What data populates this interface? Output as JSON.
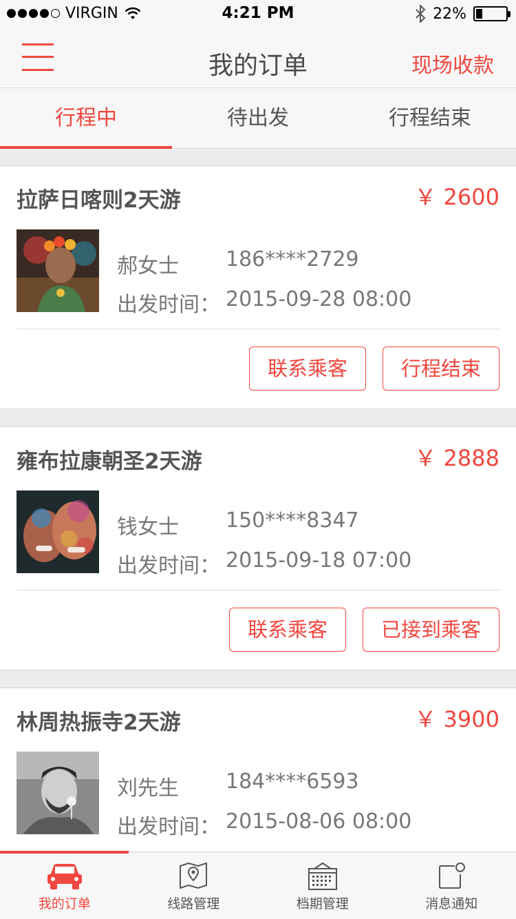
{
  "status_bar": {
    "carrier": "VIRGIN",
    "time": "4:21 PM",
    "battery": "22%",
    "battery_level": 0.22
  },
  "nav": {
    "title": "我的订单",
    "action": "现场收款",
    "menu_icon": "hamburger-menu-icon"
  },
  "tabs": [
    {
      "label": "行程中",
      "active": true
    },
    {
      "label": "待出发",
      "active": false
    },
    {
      "label": "行程结束",
      "active": false
    }
  ],
  "orders": [
    {
      "route": "拉萨日喀则2天游",
      "price": "￥ 2600",
      "passenger": "郝女士",
      "phone": "186****2729",
      "depart_label": "出发时间：",
      "depart_time": "2015-09-28  08:00",
      "actions": [
        "联系乘客",
        "行程结束"
      ]
    },
    {
      "route": "雍布拉康朝圣2天游",
      "price": "￥ 2888",
      "passenger": "钱女士",
      "phone": "150****8347",
      "depart_label": "出发时间：",
      "depart_time": "2015-09-18  07:00",
      "actions": [
        "联系乘客",
        "已接到乘客"
      ]
    },
    {
      "route": "林周热振寺2天游",
      "price": "￥ 3900",
      "passenger": "刘先生",
      "phone": "184****6593",
      "depart_label": "出发时间：",
      "depart_time": "2015-08-06  08:00",
      "actions": []
    }
  ],
  "tab_bar": [
    {
      "label": "我的订单",
      "icon": "car-icon",
      "active": true
    },
    {
      "label": "线路管理",
      "icon": "map-icon",
      "active": false
    },
    {
      "label": "档期管理",
      "icon": "calendar-icon",
      "active": false
    },
    {
      "label": "消息通知",
      "icon": "message-icon",
      "active": false
    }
  ],
  "colors": {
    "accent": "#f0473f",
    "background": "#ececec",
    "bar": "#f7f7f7"
  }
}
